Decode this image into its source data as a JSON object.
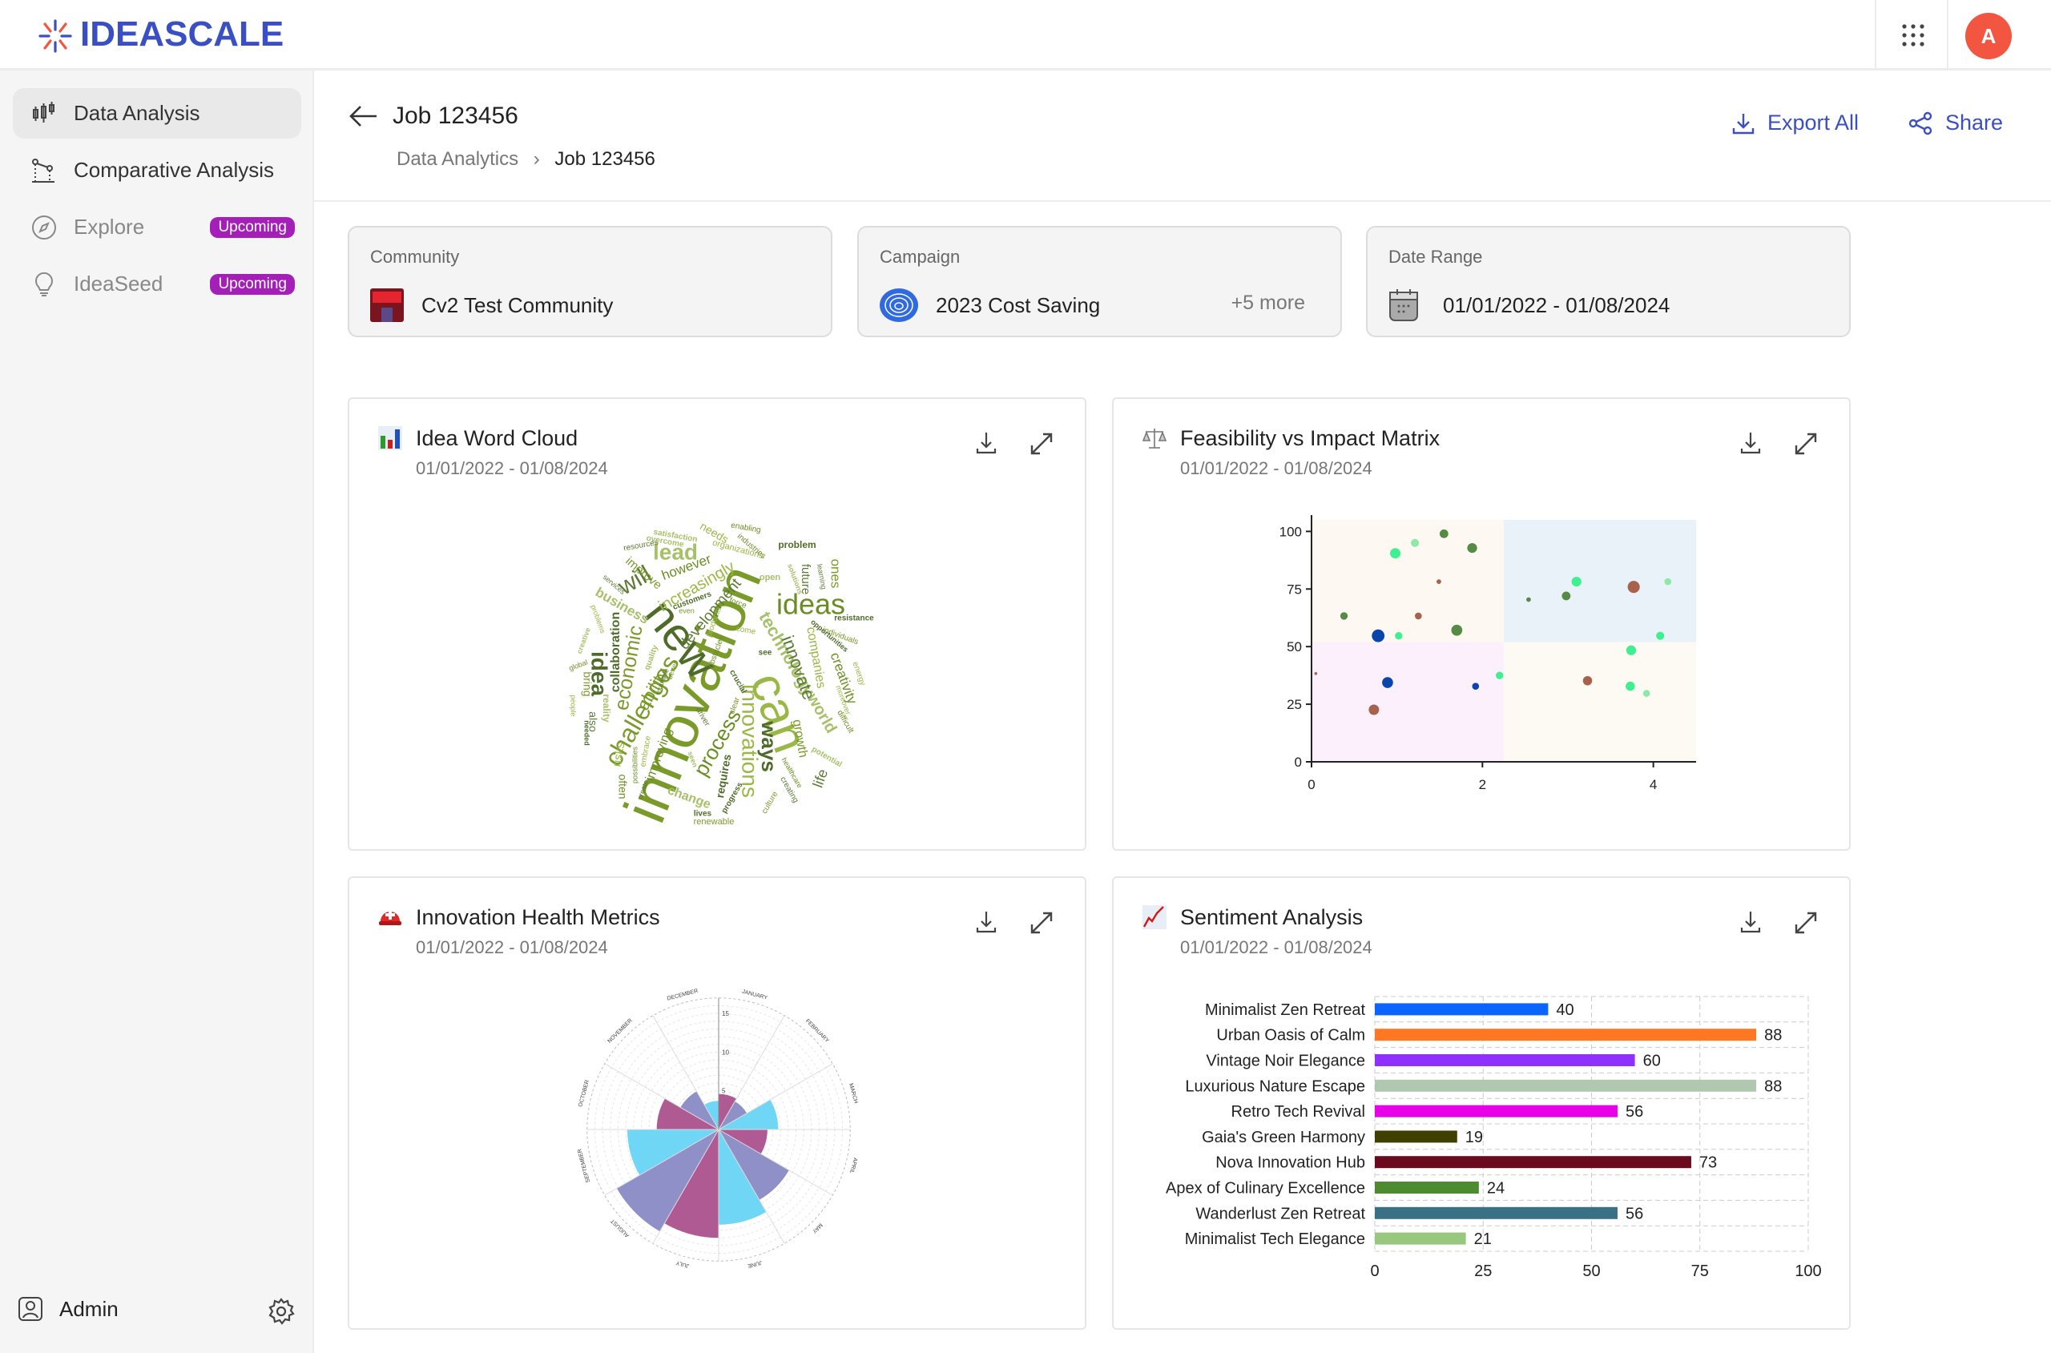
{
  "brand": {
    "name": "IDEASCALE",
    "accent": "#3a4fc4"
  },
  "topbar": {
    "apps_icon": "grid-dots-icon",
    "avatar_initial": "A",
    "avatar_color": "#f25540"
  },
  "sidebar": {
    "items": [
      {
        "label": "Data Analysis",
        "icon": "candlestick-icon",
        "active": true
      },
      {
        "label": "Comparative Analysis",
        "icon": "chart-line-icon"
      },
      {
        "label": "Explore",
        "icon": "compass-icon",
        "badge": "Upcoming"
      },
      {
        "label": "IdeaSeed",
        "icon": "lightbulb-icon",
        "badge": "Upcoming"
      }
    ],
    "footer": {
      "label": "Admin"
    },
    "badge_color": "#a31fb8"
  },
  "header": {
    "title": "Job 123456",
    "breadcrumb": [
      "Data Analytics",
      "Job 123456"
    ],
    "export_label": "Export All",
    "share_label": "Share"
  },
  "filters": {
    "community": {
      "label": "Community",
      "value": "Cv2 Test Community"
    },
    "campaign": {
      "label": "Campaign",
      "value": "2023 Cost Saving",
      "more": "+5 more"
    },
    "date": {
      "label": "Date Range",
      "value": "01/01/2022 - 01/08/2024"
    }
  },
  "cards": [
    {
      "title": "Idea Word Cloud",
      "subtitle": "01/01/2022 - 01/08/2024"
    },
    {
      "title": "Feasibility vs Impact Matrix",
      "subtitle": "01/01/2022 - 01/08/2024"
    },
    {
      "title": "Innovation Health Metrics",
      "subtitle": "01/01/2022 - 01/08/2024"
    },
    {
      "title": "Sentiment Analysis",
      "subtitle": "01/01/2022 - 01/08/2024"
    }
  ],
  "chart_data": [
    {
      "type": "wordcloud",
      "words": [
        "innovation",
        "new",
        "can",
        "ideas",
        "lead",
        "will",
        "challenges",
        "ways",
        "innovations",
        "process",
        "technology",
        "innovate",
        "economic",
        "idea",
        "increasingly",
        "however",
        "business",
        "development",
        "ability",
        "collaboration",
        "companies",
        "creativity",
        "world",
        "future",
        "ones",
        "problem",
        "needs",
        "improving",
        "change",
        "life",
        "growth",
        "requires",
        "risks",
        "often",
        "open",
        "driver",
        "renewable",
        "lives",
        "organizations",
        "enabling",
        "satisfaction",
        "resources",
        "individuals",
        "resistance",
        "energy",
        "difficult",
        "potential",
        "creating",
        "culture",
        "progress",
        "embrace",
        "possibilities",
        "reality",
        "also",
        "bring",
        "needed",
        "people",
        "global",
        "creative",
        "services",
        "improve",
        "customers",
        "products",
        "obstacles",
        "solutions",
        "learning",
        "clear",
        "see",
        "come",
        "force",
        "quality",
        "example",
        "better",
        "crucial",
        "moreover",
        "healthcare",
        "seen",
        "create",
        "even",
        "opportunities",
        "problems",
        "industries",
        "overcome"
      ]
    },
    {
      "type": "scatter",
      "xlim": [
        0,
        4.5
      ],
      "ylim": [
        0,
        105
      ],
      "xticks": [
        0,
        2,
        4
      ],
      "yticks": [
        0,
        25,
        50,
        75,
        100
      ],
      "quadrant_split": {
        "x": 2.25,
        "y": 52
      },
      "quadrant_colors": [
        "#fdf8f2",
        "#eaf2f9",
        "#fbf0fc",
        "#fdf9f3"
      ],
      "points": [
        {
          "x": 0.98,
          "y": 90.5,
          "size": 3.6,
          "color": "#3ef08f"
        },
        {
          "x": 1.21,
          "y": 95,
          "size": 2.8,
          "color": "#8fe8a8"
        },
        {
          "x": 1.55,
          "y": 99,
          "size": 3,
          "color": "#558b45"
        },
        {
          "x": 1.88,
          "y": 92.8,
          "size": 3.4,
          "color": "#558b45"
        },
        {
          "x": 1.49,
          "y": 78.2,
          "size": 1.6,
          "color": "#a8614a"
        },
        {
          "x": 0.38,
          "y": 63.3,
          "size": 2.6,
          "color": "#558b45"
        },
        {
          "x": 1.25,
          "y": 63.3,
          "size": 2.4,
          "color": "#a8614a"
        },
        {
          "x": 0.78,
          "y": 54.7,
          "size": 4.4,
          "color": "#0a45ad"
        },
        {
          "x": 1.02,
          "y": 54.7,
          "size": 2.6,
          "color": "#3ef08f"
        },
        {
          "x": 1.7,
          "y": 57.1,
          "size": 3.8,
          "color": "#558b45"
        },
        {
          "x": 2.54,
          "y": 70.4,
          "size": 1.6,
          "color": "#558b45"
        },
        {
          "x": 2.98,
          "y": 72,
          "size": 3,
          "color": "#558b45"
        },
        {
          "x": 3.1,
          "y": 78.2,
          "size": 3.4,
          "color": "#3ef08f"
        },
        {
          "x": 3.77,
          "y": 75.9,
          "size": 4.2,
          "color": "#a8614a"
        },
        {
          "x": 4.17,
          "y": 78.2,
          "size": 2.4,
          "color": "#8fe8a8"
        },
        {
          "x": 4.08,
          "y": 54.7,
          "size": 2.8,
          "color": "#3ef08f"
        },
        {
          "x": 3.74,
          "y": 48.4,
          "size": 3.4,
          "color": "#3ef08f"
        },
        {
          "x": 0.05,
          "y": 38.3,
          "size": 1,
          "color": "#a8614a"
        },
        {
          "x": 0.89,
          "y": 34.4,
          "size": 3.8,
          "color": "#0a45ad"
        },
        {
          "x": 1.92,
          "y": 32.8,
          "size": 2.4,
          "color": "#0a45ad"
        },
        {
          "x": 2.2,
          "y": 37.5,
          "size": 2.6,
          "color": "#3ef08f"
        },
        {
          "x": 0.73,
          "y": 22.6,
          "size": 3.6,
          "color": "#a8614a"
        },
        {
          "x": 3.23,
          "y": 35.2,
          "size": 3.2,
          "color": "#a8614a"
        },
        {
          "x": 3.73,
          "y": 32.8,
          "size": 3.2,
          "color": "#3ef08f"
        },
        {
          "x": 3.92,
          "y": 29.7,
          "size": 2.4,
          "color": "#8fe8a8"
        }
      ]
    },
    {
      "type": "polar-area",
      "categories": [
        "JANUARY",
        "FEBRUARY",
        "MARCH",
        "APRIL",
        "MAY",
        "JUNE",
        "JULY",
        "AUGUST",
        "SEPTEMBER",
        "OCTOBER",
        "NOVEMBER",
        "DECEMBER"
      ],
      "values": [
        4.6,
        4.2,
        7.7,
        6.3,
        10.5,
        12.3,
        14,
        15.2,
        11.8,
        8,
        5.7,
        3.7
      ],
      "colors": [
        "#b05a94",
        "#9090c8",
        "#6fd6f5"
      ],
      "rticks": [
        5,
        10,
        15
      ],
      "rmax": 17
    },
    {
      "type": "bar",
      "orientation": "horizontal",
      "categories": [
        "Minimalist Zen Retreat",
        "Urban Oasis of Calm",
        "Vintage Noir Elegance",
        "Luxurious Nature Escape",
        "Retro Tech Revival",
        "Gaia's Green Harmony",
        "Nova Innovation Hub",
        "Apex of Culinary Excellence",
        "Wanderlust Zen Retreat",
        "Minimalist Tech Elegance"
      ],
      "values": [
        40,
        88,
        60,
        88,
        56,
        19,
        73,
        24,
        56,
        21
      ],
      "colors": [
        "#0a64ff",
        "#ff7722",
        "#9030ff",
        "#b0c8b0",
        "#e800e8",
        "#3f3f00",
        "#6a0a1c",
        "#4e8a30",
        "#3a7085",
        "#98c880"
      ],
      "xlim": [
        0,
        100
      ],
      "xticks": [
        0,
        25,
        50,
        75,
        100
      ],
      "grid": true
    }
  ]
}
